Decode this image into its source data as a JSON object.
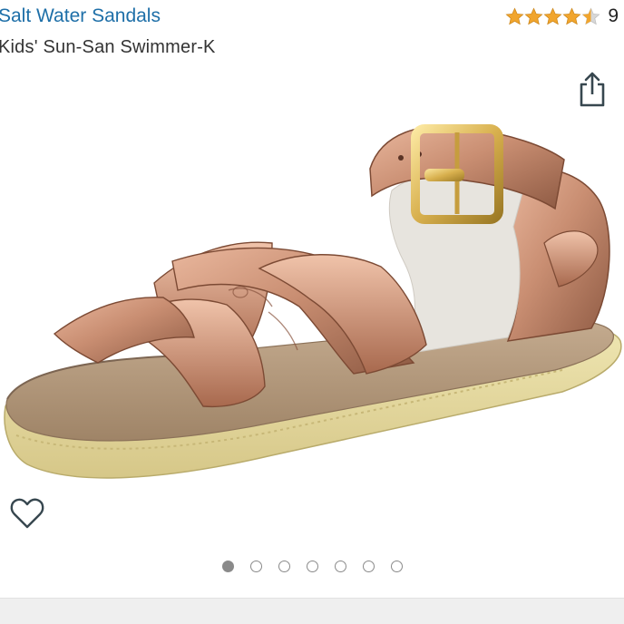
{
  "product": {
    "brand": "Salt Water Sandals",
    "title": "Kids' Sun-San Swimmer-K"
  },
  "rating": {
    "value": 4.5,
    "max": 5,
    "review_count": "9",
    "star_color": "#f1a52d",
    "empty_star_color": "#d7d7d7"
  },
  "image": {
    "alt": "Rose gold Salt Water sandal with buckle strap",
    "subject": "sandal-photo"
  },
  "carousel": {
    "count": 7,
    "active_index": 0
  },
  "icons": {
    "share": "share-icon",
    "wishlist": "heart-outline-icon"
  },
  "colors": {
    "brand_link": "#1e6fa8",
    "title_text": "#333333",
    "icon": "#37474f"
  }
}
